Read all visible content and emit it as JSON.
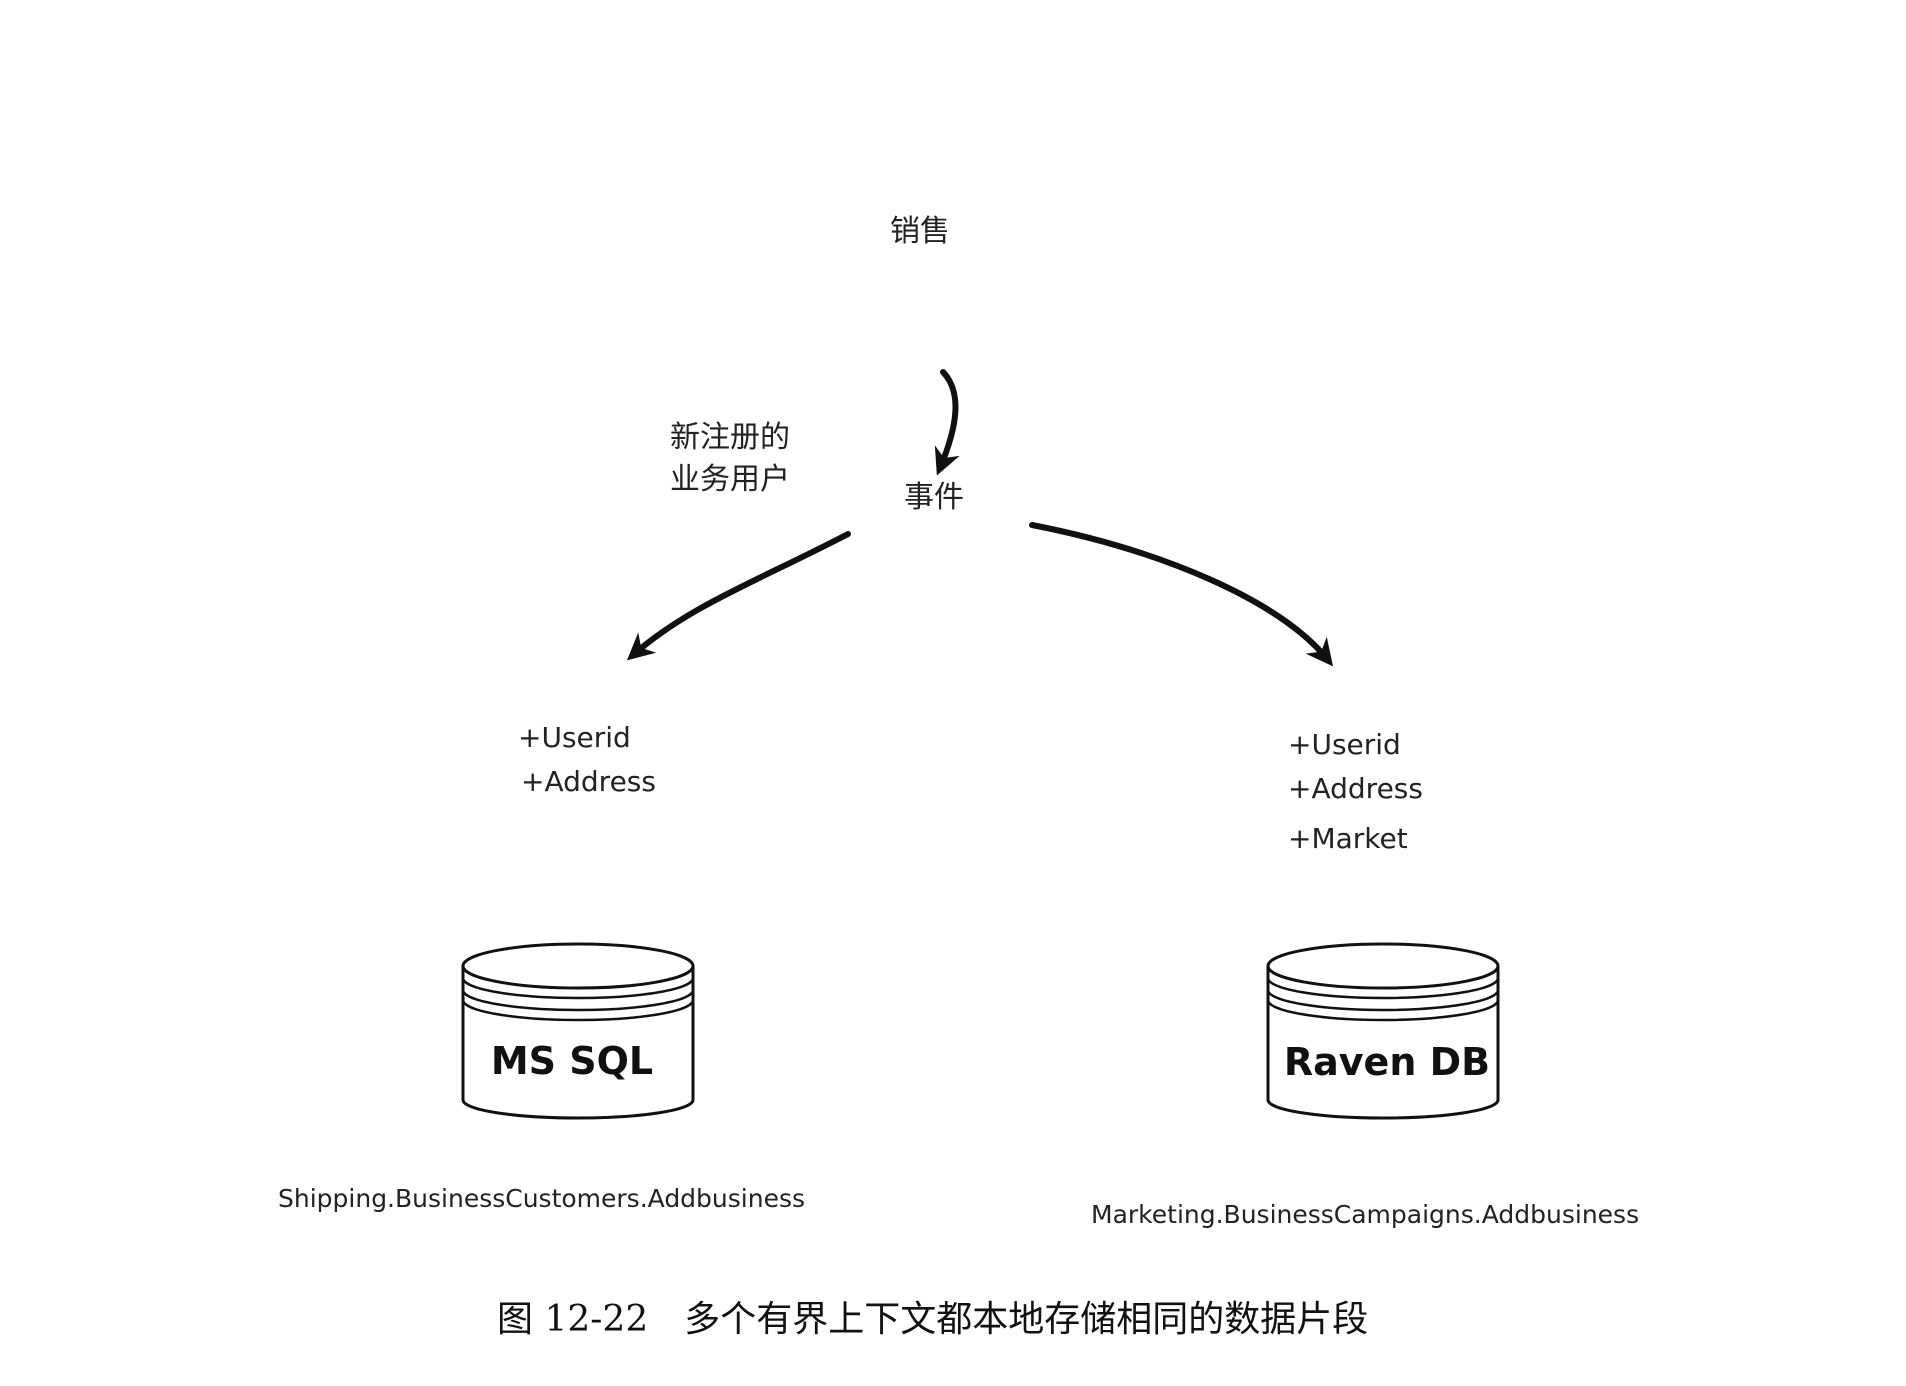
{
  "diagram": {
    "sales_label": "销售",
    "event_name_lines": [
      "新注册的",
      "业务用户"
    ],
    "event_label": "事件",
    "left_db": {
      "name": "MS SQL",
      "fields": [
        "+Userid",
        "+Address"
      ],
      "handler": "Shipping.BusinessCustomers.Addbusiness"
    },
    "right_db": {
      "name": "Raven DB",
      "fields": [
        "+Userid",
        "+Address",
        "+Market"
      ],
      "handler": "Marketing.BusinessCampaigns.Addbusiness"
    },
    "caption": "图 12-22　多个有界上下文都本地存储相同的数据片段"
  }
}
